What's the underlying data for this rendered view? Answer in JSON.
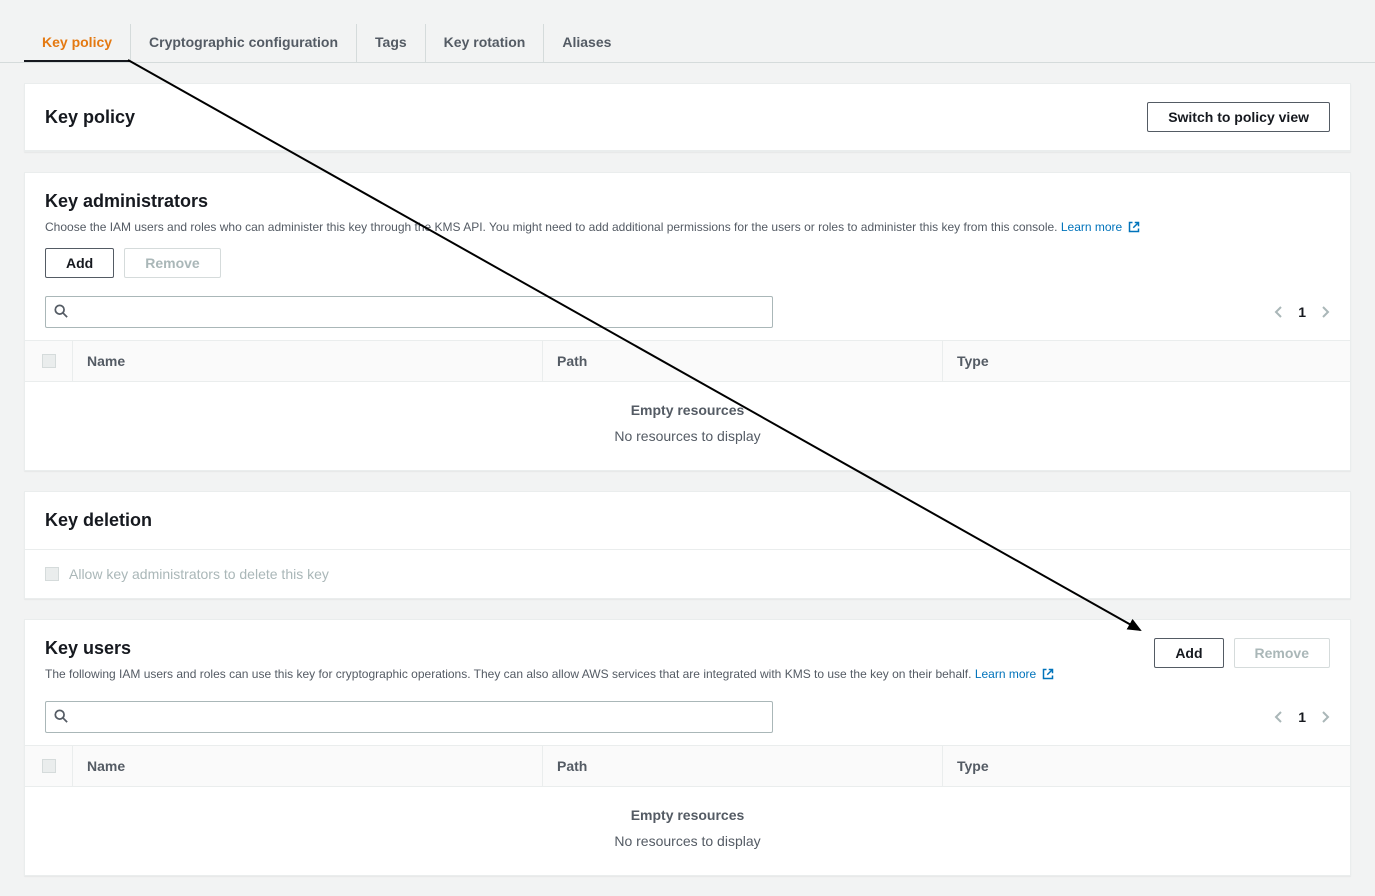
{
  "tabs": [
    {
      "label": "Key policy",
      "active": true
    },
    {
      "label": "Cryptographic configuration",
      "active": false
    },
    {
      "label": "Tags",
      "active": false
    },
    {
      "label": "Key rotation",
      "active": false
    },
    {
      "label": "Aliases",
      "active": false
    }
  ],
  "key_policy": {
    "title": "Key policy",
    "switch_btn": "Switch to policy view"
  },
  "admins": {
    "title": "Key administrators",
    "desc": "Choose the IAM users and roles who can administer this key through the KMS API. You might need to add additional permissions for the users or roles to administer this key from this console. ",
    "learn_more": "Learn more",
    "add_btn": "Add",
    "remove_btn": "Remove",
    "page": "1",
    "columns": {
      "name": "Name",
      "path": "Path",
      "type": "Type"
    },
    "empty_title": "Empty resources",
    "empty_sub": "No resources to display"
  },
  "deletion": {
    "title": "Key deletion",
    "checkbox_label": "Allow key administrators to delete this key"
  },
  "users": {
    "title": "Key users",
    "desc": "The following IAM users and roles can use this key for cryptographic operations. They can also allow AWS services that are integrated with KMS to use the key on their behalf. ",
    "learn_more": "Learn more",
    "add_btn": "Add",
    "remove_btn": "Remove",
    "page": "1",
    "columns": {
      "name": "Name",
      "path": "Path",
      "type": "Type"
    },
    "empty_title": "Empty resources",
    "empty_sub": "No resources to display"
  }
}
